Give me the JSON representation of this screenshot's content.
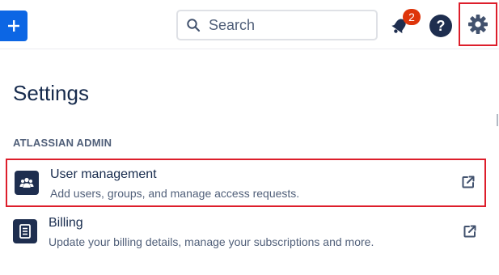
{
  "topbar": {
    "add_button_glyph": "+",
    "search": {
      "placeholder": "Search",
      "value": ""
    },
    "notifications": {
      "count": "2"
    },
    "help_glyph": "?"
  },
  "page": {
    "title": "Settings"
  },
  "section": {
    "heading": "ATLASSIAN ADMIN",
    "items": [
      {
        "title": "User management",
        "description": "Add users, groups, and manage access requests.",
        "icon": "people-icon",
        "external": true
      },
      {
        "title": "Billing",
        "description": "Update your billing details, manage your subscriptions and more.",
        "icon": "document-icon",
        "external": true
      }
    ]
  },
  "colors": {
    "primary": "#0c66e4",
    "navy": "#1e2e4f",
    "text": "#172b4d",
    "subtle_text": "#505f79",
    "badge": "#de350b",
    "annotation_red": "#dd1e2b"
  }
}
